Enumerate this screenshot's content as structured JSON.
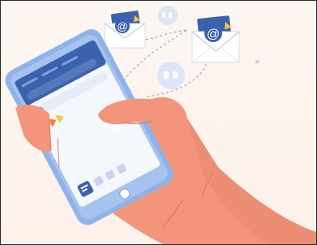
{
  "illustration": {
    "email_symbol": "@",
    "icons": [
      "email-envelope-icon",
      "email-envelope-icon",
      "quote-bubble-icon",
      "quote-bubble-icon",
      "search-icon",
      "chat-bubble-icon",
      "home-button-icon"
    ],
    "colors": {
      "background": "#fdf3ec",
      "phone_body": "#8eb3ea",
      "phone_screen": "#f4f7fc",
      "app_header": "#3d62ad",
      "hand": "#f2957a",
      "hand_shadow": "#e07b63",
      "envelope": "#ffffff",
      "envelope_accent": "#3d62ad",
      "bubble": "#dde6f6",
      "logo_orange": "#f47d3b",
      "accent_yellow": "#f7c744"
    }
  }
}
